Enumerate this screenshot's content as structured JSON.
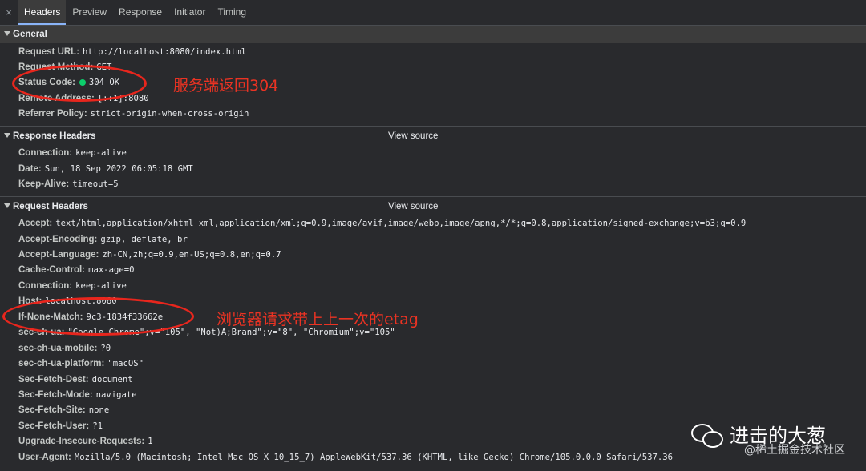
{
  "tabs": {
    "close": "×",
    "items": [
      "Headers",
      "Preview",
      "Response",
      "Initiator",
      "Timing"
    ]
  },
  "general": {
    "title": "General",
    "rows": [
      {
        "key": "Request URL:",
        "value": "http://localhost:8080/index.html"
      },
      {
        "key": "Request Method:",
        "value": "GET"
      },
      {
        "key": "Status Code:",
        "value": "304 OK"
      },
      {
        "key": "Remote Address:",
        "value": "[::1]:8080"
      },
      {
        "key": "Referrer Policy:",
        "value": "strict-origin-when-cross-origin"
      }
    ]
  },
  "response_headers": {
    "title": "Response Headers",
    "view_source": "View source",
    "rows": [
      {
        "key": "Connection:",
        "value": "keep-alive"
      },
      {
        "key": "Date:",
        "value": "Sun, 18 Sep 2022 06:05:18 GMT"
      },
      {
        "key": "Keep-Alive:",
        "value": "timeout=5"
      }
    ]
  },
  "request_headers": {
    "title": "Request Headers",
    "view_source": "View source",
    "rows": [
      {
        "key": "Accept:",
        "value": "text/html,application/xhtml+xml,application/xml;q=0.9,image/avif,image/webp,image/apng,*/*;q=0.8,application/signed-exchange;v=b3;q=0.9"
      },
      {
        "key": "Accept-Encoding:",
        "value": "gzip, deflate, br"
      },
      {
        "key": "Accept-Language:",
        "value": "zh-CN,zh;q=0.9,en-US;q=0.8,en;q=0.7"
      },
      {
        "key": "Cache-Control:",
        "value": "max-age=0"
      },
      {
        "key": "Connection:",
        "value": "keep-alive"
      },
      {
        "key": "Host:",
        "value": "localhost:8080"
      },
      {
        "key": "If-None-Match:",
        "value": "9c3-1834f33662e"
      },
      {
        "key": "sec-ch-ua:",
        "value": "\"Google Chrome\";v=\"105\", \"Not)A;Brand\";v=\"8\", \"Chromium\";v=\"105\""
      },
      {
        "key": "sec-ch-ua-mobile:",
        "value": "?0"
      },
      {
        "key": "sec-ch-ua-platform:",
        "value": "\"macOS\""
      },
      {
        "key": "Sec-Fetch-Dest:",
        "value": "document"
      },
      {
        "key": "Sec-Fetch-Mode:",
        "value": "navigate"
      },
      {
        "key": "Sec-Fetch-Site:",
        "value": "none"
      },
      {
        "key": "Sec-Fetch-User:",
        "value": "?1"
      },
      {
        "key": "Upgrade-Insecure-Requests:",
        "value": "1"
      },
      {
        "key": "User-Agent:",
        "value": "Mozilla/5.0 (Macintosh; Intel Mac OS X 10_15_7) AppleWebKit/537.36 (KHTML, like Gecko) Chrome/105.0.0.0 Safari/537.36"
      }
    ]
  },
  "annotations": {
    "status": "服务端返回304",
    "etag": "浏览器请求带上上一次的etag",
    "color": "#e8261d"
  },
  "watermark": {
    "icon": "wechat-icon",
    "name": "进击的大葱",
    "sub": "@稀土掘金技术社区"
  },
  "colors": {
    "background": "#292a2d",
    "status_dot": "#0cce6b",
    "active_tab_underline": "#8ab4f8"
  }
}
